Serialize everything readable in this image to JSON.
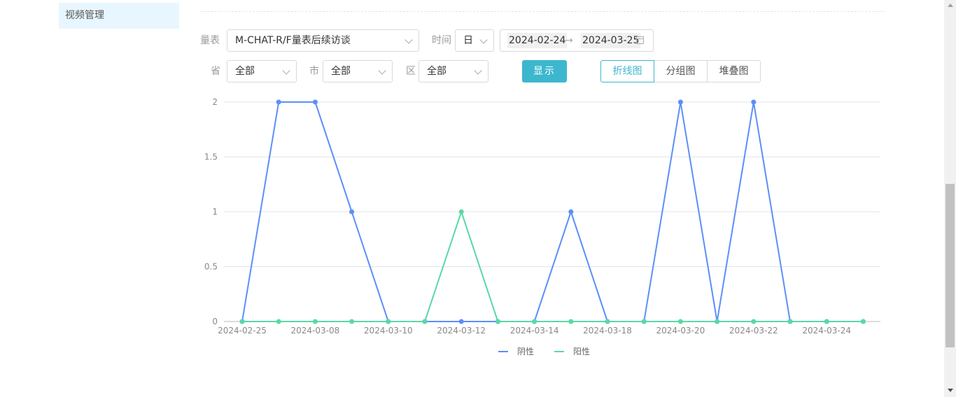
{
  "sidebar": {
    "items": [
      {
        "label": "视频管理"
      }
    ]
  },
  "filters": {
    "scale_label": "量表",
    "scale_value": "M-CHAT-R/F量表后续访谈",
    "time_label": "时间",
    "time_unit": "日",
    "date_start": "2024-02-24",
    "date_arrow": "→",
    "date_end": "2024-03-25",
    "province_label": "省",
    "province_value": "全部",
    "city_label": "市",
    "city_value": "全部",
    "district_label": "区",
    "district_value": "全部",
    "show_button": "显示",
    "chart_types": [
      "折线图",
      "分组图",
      "堆叠图"
    ],
    "active_chart_type": "折线图"
  },
  "colors": {
    "negative": "#5b8ff9",
    "positive": "#5ad8a6",
    "accent": "#3cb7ce"
  },
  "chart_data": {
    "type": "line",
    "x": [
      "2024-02-25",
      "2024-03-07",
      "2024-03-08",
      "2024-03-09",
      "2024-03-10",
      "2024-03-11",
      "2024-03-12",
      "2024-03-13",
      "2024-03-14",
      "2024-03-15",
      "2024-03-18",
      "2024-03-19",
      "2024-03-20",
      "2024-03-21",
      "2024-03-22",
      "2024-03-23",
      "2024-03-24",
      "2024-03-25"
    ],
    "tick_labels": [
      "2024-02-25",
      "2024-03-08",
      "2024-03-10",
      "2024-03-12",
      "2024-03-14",
      "2024-03-18",
      "2024-03-20",
      "2024-03-22",
      "2024-03-24"
    ],
    "yticks": [
      "0",
      "0.5",
      "1",
      "1.5",
      "2"
    ],
    "ylim": [
      0,
      2
    ],
    "series": [
      {
        "name": "阴性",
        "color": "#5b8ff9",
        "values": [
          0,
          2,
          2,
          1,
          0,
          0,
          0,
          0,
          0,
          1,
          0,
          0,
          2,
          0,
          2,
          0,
          0,
          0
        ]
      },
      {
        "name": "阳性",
        "color": "#5ad8a6",
        "values": [
          0,
          0,
          0,
          0,
          0,
          0,
          1,
          0,
          0,
          0,
          0,
          0,
          0,
          0,
          0,
          0,
          0,
          0
        ]
      }
    ],
    "grid": true,
    "legend_position": "bottom"
  }
}
